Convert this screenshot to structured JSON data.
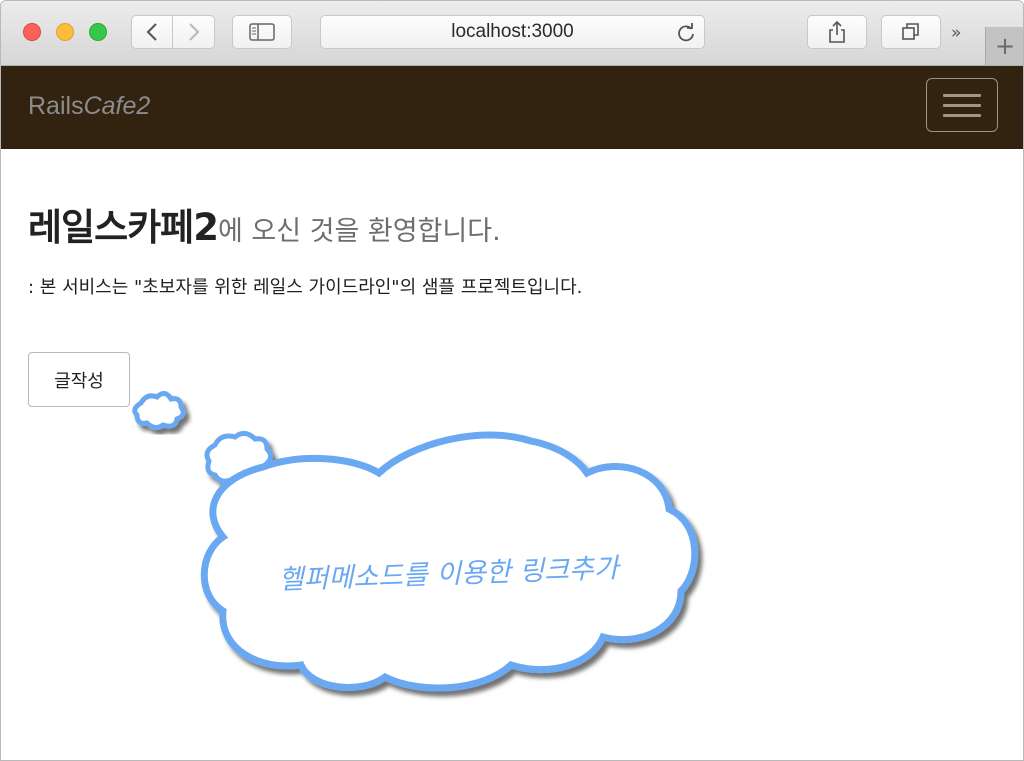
{
  "browser": {
    "address": "localhost:3000",
    "new_tab_symbol": "+",
    "overflow_symbol": "»"
  },
  "navbar": {
    "brand_regular": "Rails",
    "brand_italic": "Cafe2",
    "background": "#31230f"
  },
  "main": {
    "heading_bold": "레일스카페2",
    "heading_light": "에 오신 것을 환영합니다.",
    "subtitle": ": 본 서비스는 \"초보자를 위한 레일스 가이드라인\"의 샘플 프로젝트입니다.",
    "write_button_label": "글작성"
  },
  "annotation": {
    "text": "헬퍼메소드를 이용한 링크추가",
    "color": "#6aa9f2"
  }
}
